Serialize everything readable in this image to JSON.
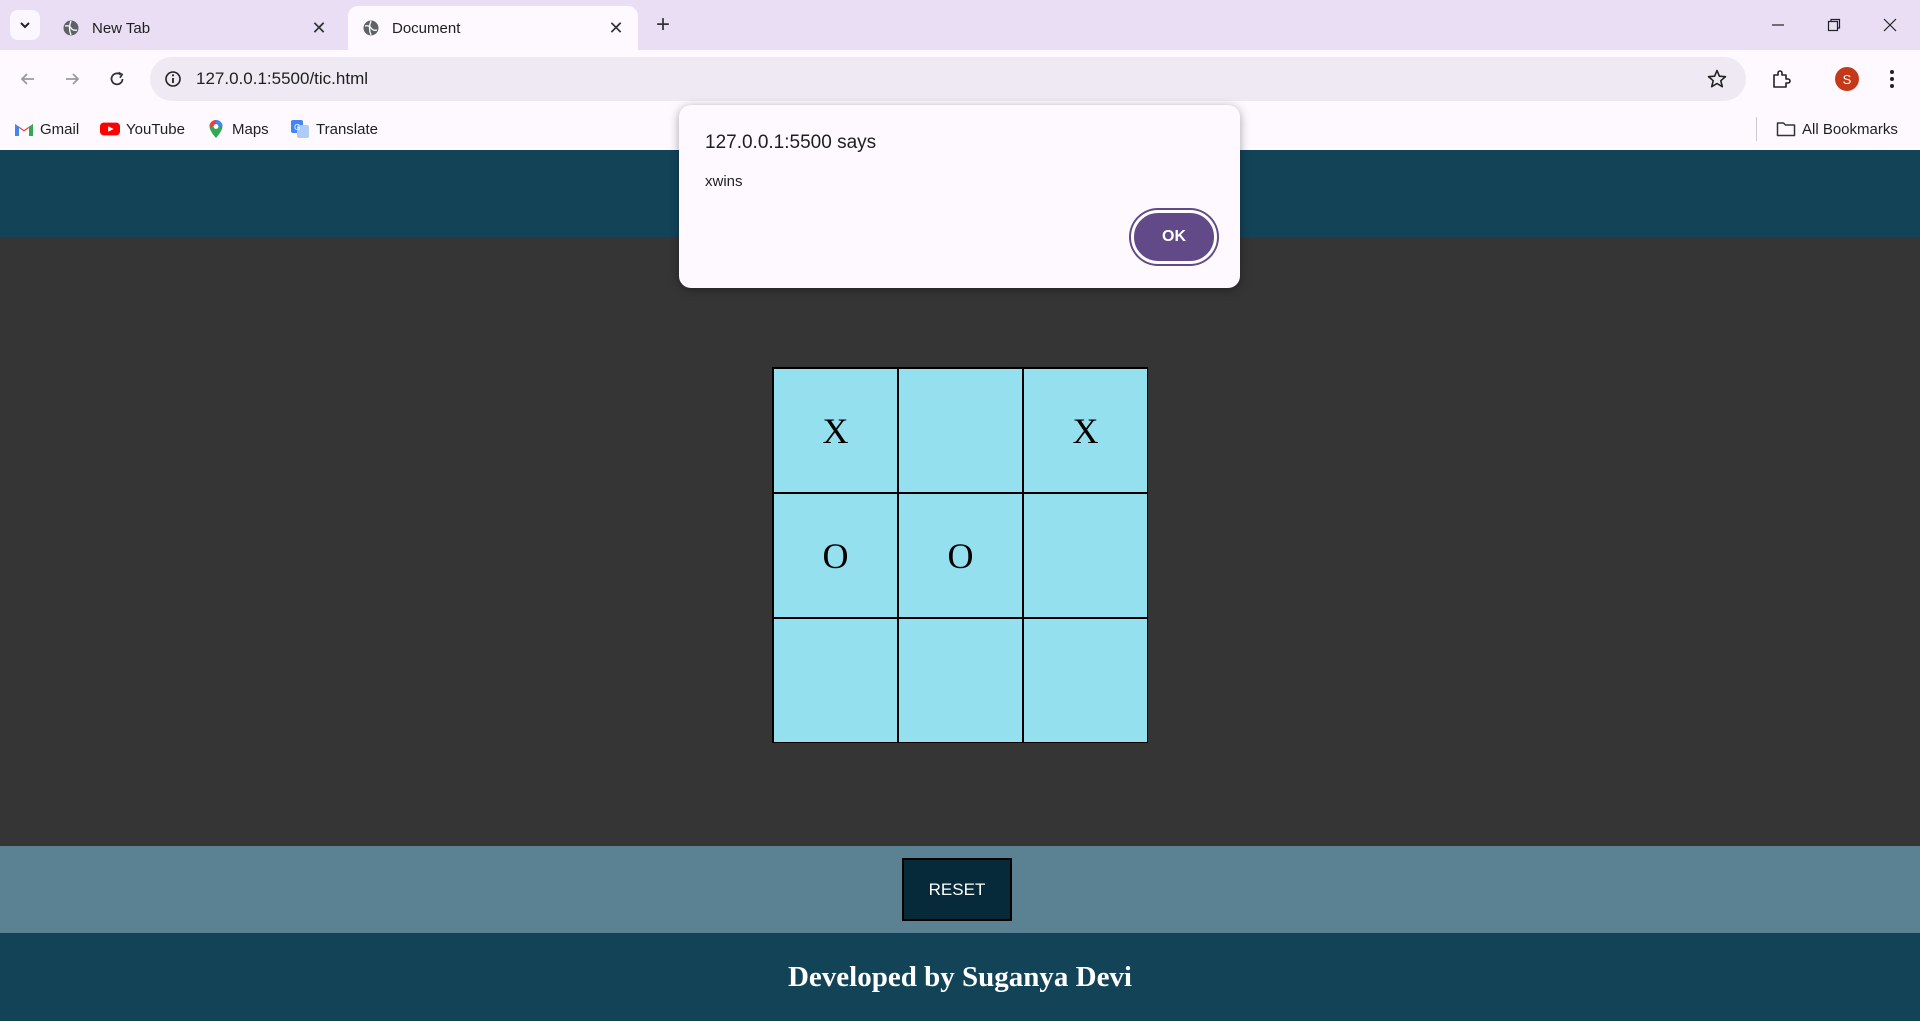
{
  "browser": {
    "tabs": [
      {
        "title": "New Tab",
        "active": false
      },
      {
        "title": "Document",
        "active": true
      }
    ],
    "address": "127.0.0.1:5500/tic.html",
    "profile_initial": "S",
    "bookmarks": [
      {
        "label": "Gmail",
        "icon": "gmail-icon"
      },
      {
        "label": "YouTube",
        "icon": "youtube-icon"
      },
      {
        "label": "Maps",
        "icon": "maps-icon"
      },
      {
        "label": "Translate",
        "icon": "translate-icon"
      }
    ],
    "all_bookmarks": "All Bookmarks"
  },
  "alert": {
    "title": "127.0.0.1:5500 says",
    "message": "xwins",
    "ok_label": "OK"
  },
  "game": {
    "cells": [
      "X",
      "",
      "X",
      "O",
      "O",
      "",
      "",
      "",
      ""
    ]
  },
  "reset_label": "RESET",
  "footer": "Developed by Suganya Devi",
  "colors": {
    "header": "#134357",
    "board_cell": "#95e0ef",
    "page_bg": "#353535",
    "reset_bar": "#5a8292",
    "reset_button": "#062a3a",
    "dialog_ok": "#614a87"
  }
}
